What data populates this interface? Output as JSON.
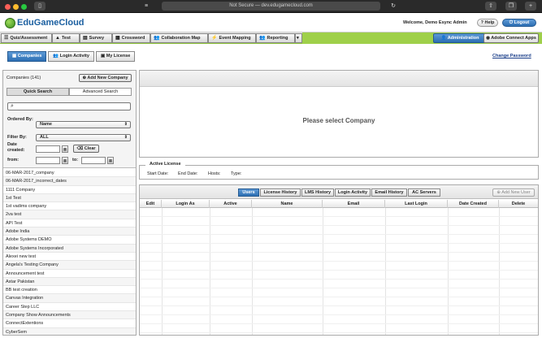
{
  "browser": {
    "address": "Not Secure — dev.edugamecloud.com"
  },
  "header": {
    "logo_text": "EduGameCloud",
    "welcome": "Welcome, Demo Esync Admin",
    "help_label": "Help",
    "logout_label": "Logout"
  },
  "menu": {
    "items": [
      "Quiz/Assessment",
      "Test",
      "Survey",
      "Crossword",
      "Collaboration Map",
      "Event Mapping",
      "Reporting"
    ],
    "administration_label": "Administration",
    "adobe_connect_label": "Adobe Connect Apps"
  },
  "subtabs": {
    "items": [
      "Companies",
      "Login Activity",
      "My License"
    ],
    "active": "Companies",
    "change_password": "Change Password"
  },
  "left_panel": {
    "companies_label": "Companies (141)",
    "add_company_label": "Add New Company",
    "search_tabs": [
      "Quick Search",
      "Advanced Search"
    ],
    "ordered_by_label": "Ordered By:",
    "ordered_by_value": "Name",
    "filter_by_label": "Filter By:",
    "filter_by_value": "ALL",
    "date_created_label": "Date created:",
    "from_label": "from:",
    "to_label": "to:",
    "clear_label": "Clear",
    "companies": [
      "06-MAR-2017_company",
      "06-MAR-2017_incorrect_dates",
      "1111 Company",
      "1st Test",
      "1st vadims company",
      "2va test",
      "API Test",
      "Adobe India",
      "Adobe Systems DEMO",
      "Adobe Systems Incorporated",
      "Alexei new test",
      "Angela's Testing Company",
      "Announcement test",
      "Astar Pakistan",
      "BB test creation",
      "Canvas Integration",
      "Career Step LLC",
      "Company Show Announcements",
      "ConnectExtentions",
      "CyberSem"
    ]
  },
  "detail": {
    "placeholder": "Please select Company"
  },
  "license": {
    "title": "Active License",
    "start_date_label": "Start Date:",
    "end_date_label": "End Date:",
    "hosts_label": "Hosts:",
    "type_label": "Type:"
  },
  "grid": {
    "tabs": [
      "Users",
      "License History",
      "LMS History",
      "Login Activity",
      "Email History",
      "AC Servers"
    ],
    "active_tab": "Users",
    "add_user_label": "Add New User",
    "columns": [
      "Edit",
      "Login As",
      "Active",
      "Name",
      "Email",
      "Last Login",
      "Date Created",
      "Delete"
    ]
  }
}
